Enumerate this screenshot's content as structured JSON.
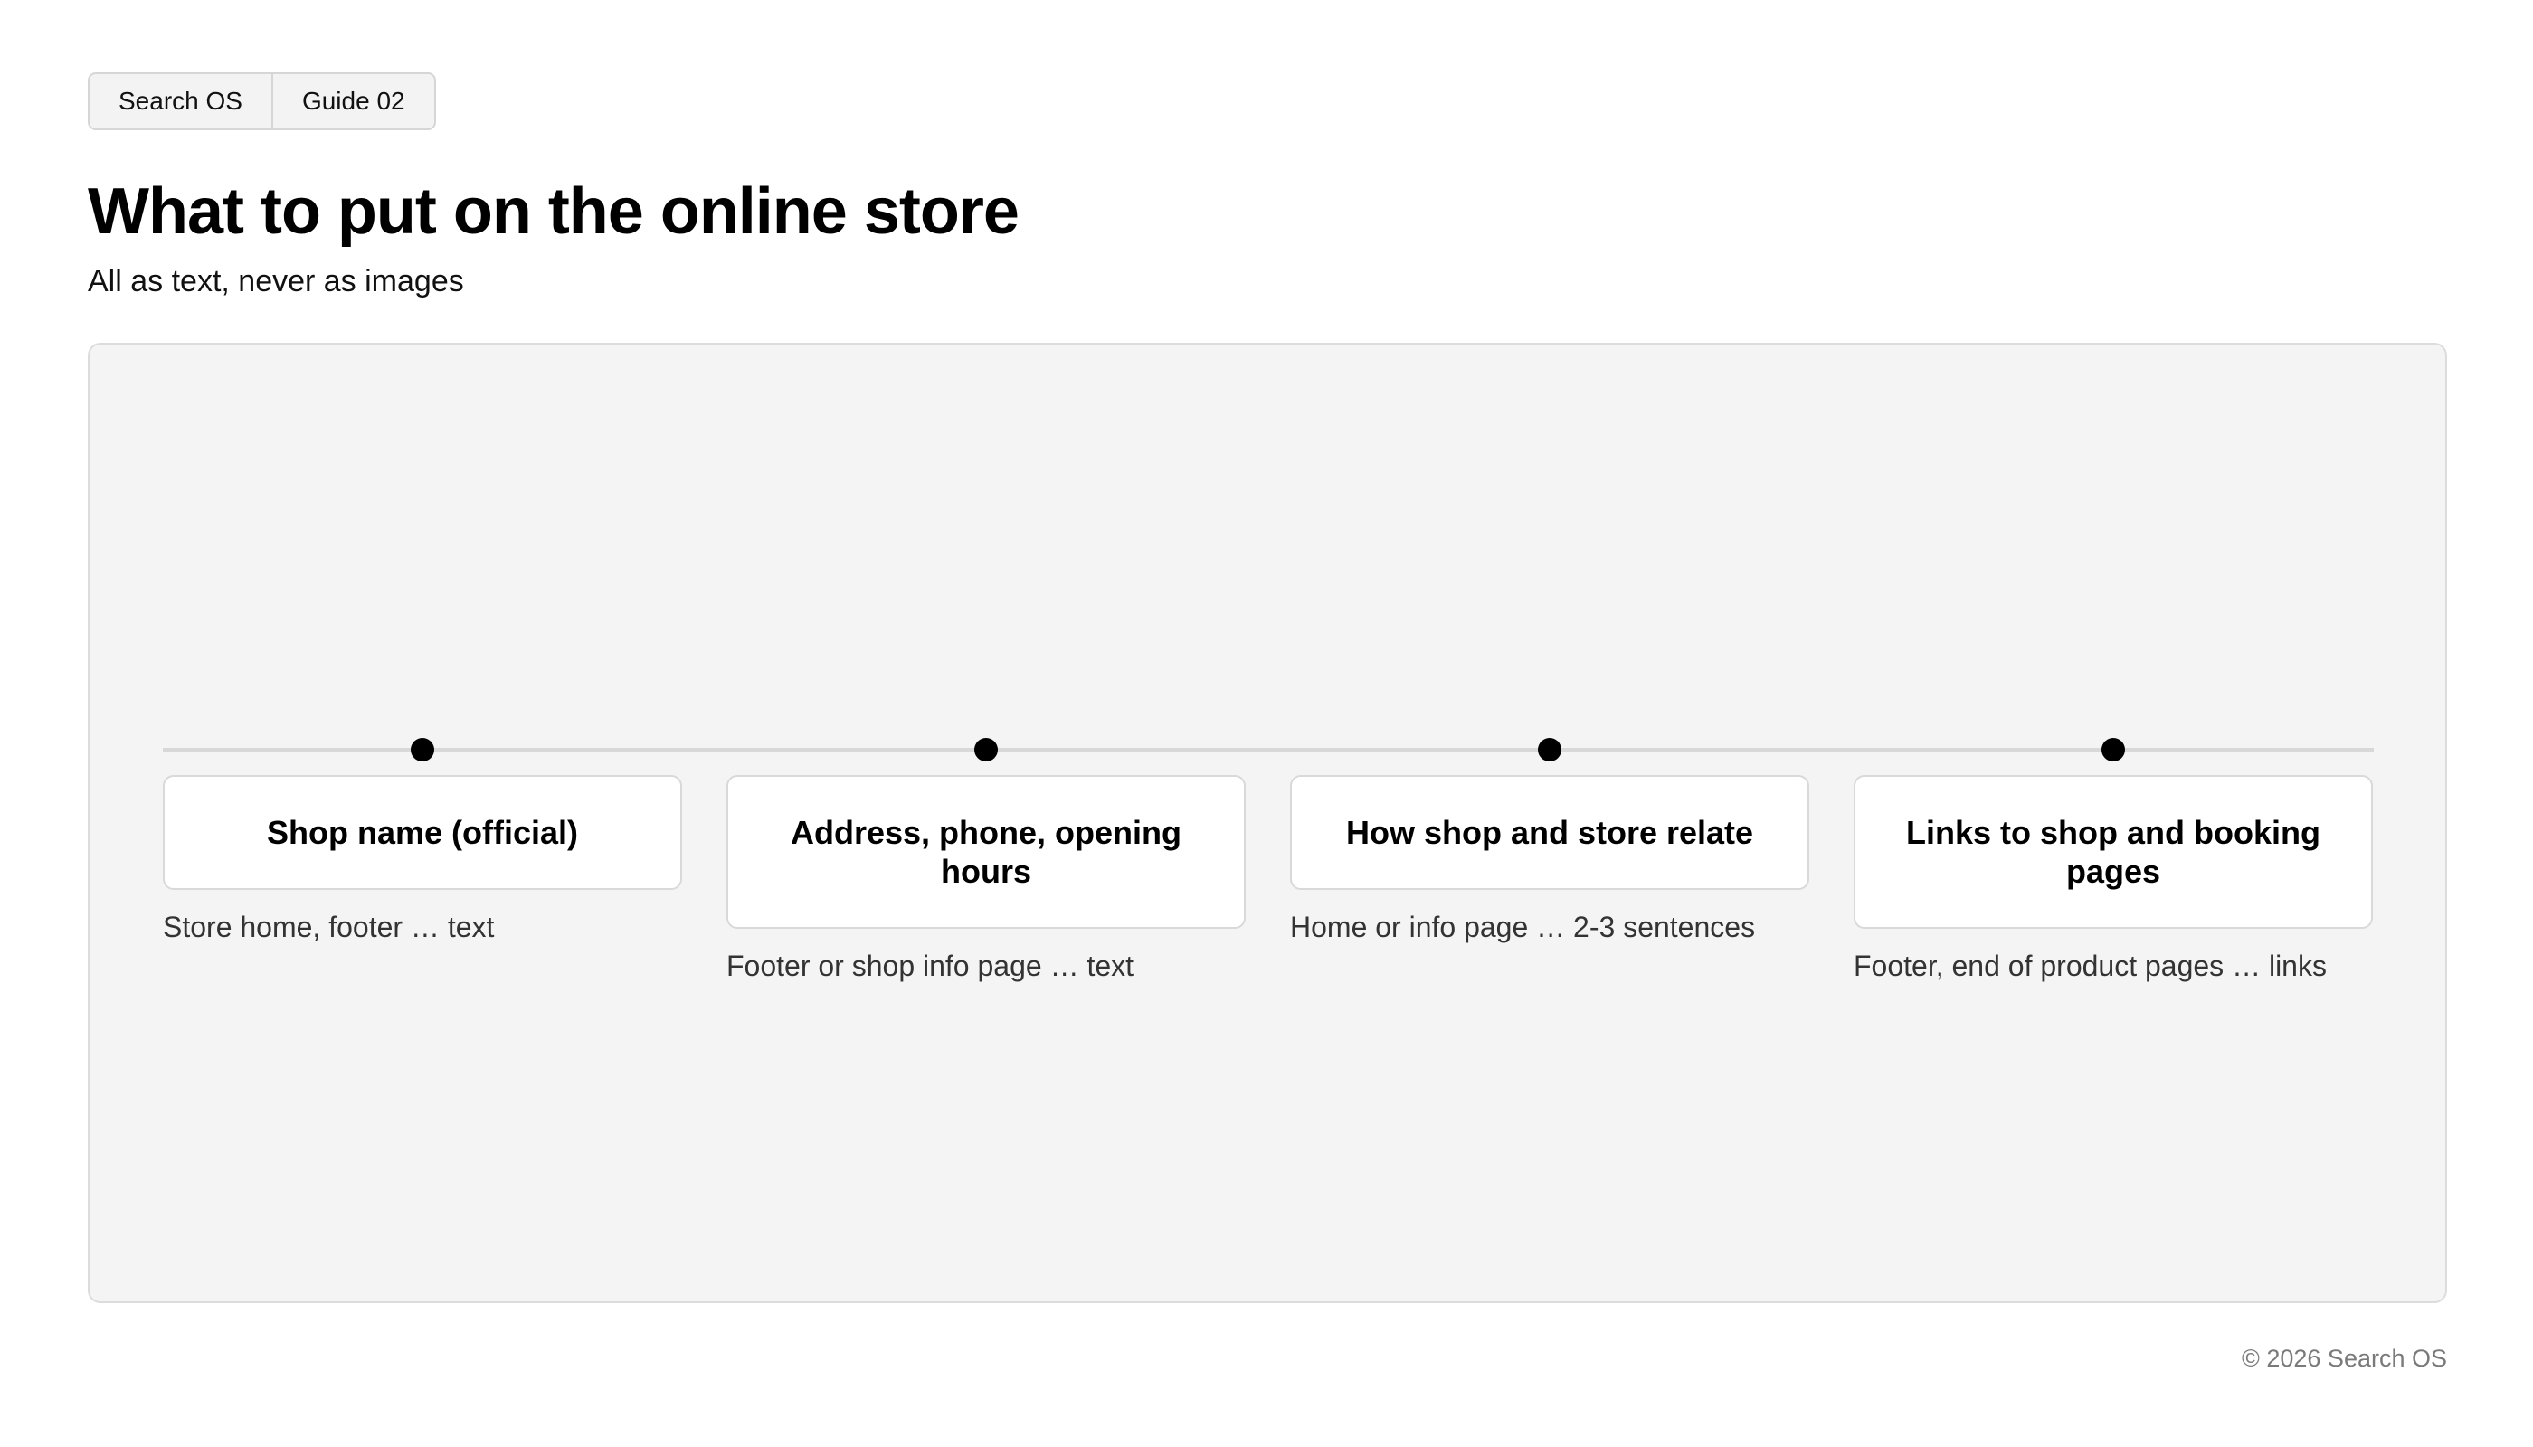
{
  "breadcrumb": {
    "items": [
      "Search OS",
      "Guide 02"
    ]
  },
  "header": {
    "title": "What to put on the online store",
    "subtitle": "All as text, never as images"
  },
  "diagram": {
    "steps": [
      {
        "title": "Shop name (official)",
        "note": "Store home, footer … text"
      },
      {
        "title": "Address, phone, opening hours",
        "note": "Footer or shop info page … text"
      },
      {
        "title": "How shop and store relate",
        "note": "Home or info page … 2-3 sentences"
      },
      {
        "title": "Links to shop and booking pages",
        "note": "Footer, end of product pages … links"
      }
    ]
  },
  "footer": {
    "copyright": "© 2026 Search OS"
  },
  "colors": {
    "panel_background": "#f4f4f4",
    "card_background": "#ffffff",
    "dot": "#000000",
    "line": "#d8d8d8"
  }
}
